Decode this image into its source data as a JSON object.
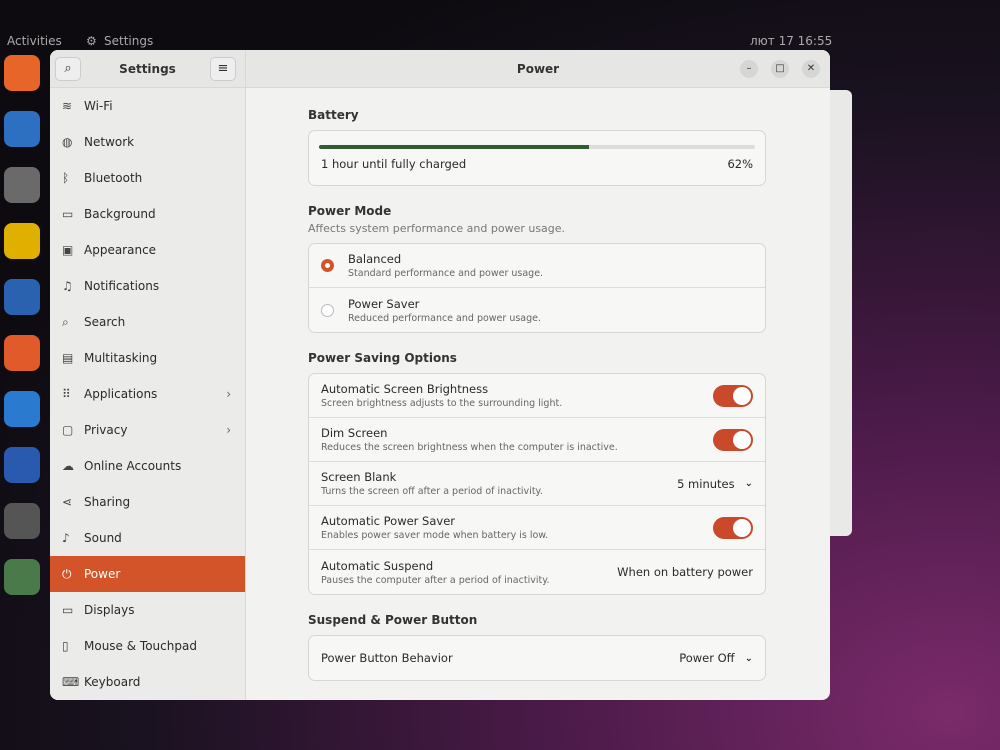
{
  "topbar": {
    "activities": "Activities",
    "app": "Settings",
    "datetime": "лют 17  16:55"
  },
  "dock": [
    {
      "icon": "firefox-icon",
      "color": "#e8652a"
    },
    {
      "icon": "thunderbird-icon",
      "color": "#2d6fc0"
    },
    {
      "icon": "files-icon",
      "color": "#6a6a6a"
    },
    {
      "icon": "rhythmbox-icon",
      "color": "#e0b000"
    },
    {
      "icon": "writer-icon",
      "color": "#2a62b0"
    },
    {
      "icon": "software-icon",
      "color": "#e05a2a"
    },
    {
      "icon": "help-icon",
      "color": "#2a7ad0"
    },
    {
      "icon": "updater-icon",
      "color": "#2a5ab0"
    },
    {
      "icon": "settings-icon",
      "color": "#555"
    },
    {
      "icon": "trash-icon",
      "color": "#4a7a4a"
    }
  ],
  "sidebar": {
    "title": "Settings",
    "items": [
      {
        "label": "Wi-Fi",
        "icon": "wifi-icon",
        "glyph": "≋"
      },
      {
        "label": "Network",
        "icon": "network-icon",
        "glyph": "◍"
      },
      {
        "label": "Bluetooth",
        "icon": "bluetooth-icon",
        "glyph": "ᛒ"
      },
      {
        "label": "Background",
        "icon": "background-icon",
        "glyph": "▭"
      },
      {
        "label": "Appearance",
        "icon": "appearance-icon",
        "glyph": "▣"
      },
      {
        "label": "Notifications",
        "icon": "bell-icon",
        "glyph": "♫"
      },
      {
        "label": "Search",
        "icon": "search-icon",
        "glyph": "⌕"
      },
      {
        "label": "Multitasking",
        "icon": "multitasking-icon",
        "glyph": "▤"
      },
      {
        "label": "Applications",
        "icon": "apps-icon",
        "glyph": "⠿",
        "chev": "›"
      },
      {
        "label": "Privacy",
        "icon": "lock-icon",
        "glyph": "▢",
        "chev": "›"
      },
      {
        "label": "Online Accounts",
        "icon": "cloud-icon",
        "glyph": "☁"
      },
      {
        "label": "Sharing",
        "icon": "share-icon",
        "glyph": "⋖"
      },
      {
        "label": "Sound",
        "icon": "music-icon",
        "glyph": "♪"
      },
      {
        "label": "Power",
        "icon": "power-icon",
        "glyph": "⏻",
        "active": true
      },
      {
        "label": "Displays",
        "icon": "display-icon",
        "glyph": "▭"
      },
      {
        "label": "Mouse & Touchpad",
        "icon": "mouse-icon",
        "glyph": "▯"
      },
      {
        "label": "Keyboard",
        "icon": "keyboard-icon",
        "glyph": "⌨"
      }
    ]
  },
  "main": {
    "title": "Power",
    "battery": {
      "heading": "Battery",
      "status": "1 hour until fully charged",
      "percent": "62%",
      "level": 0.62
    },
    "power_mode": {
      "heading": "Power Mode",
      "subtitle": "Affects system performance and power usage.",
      "options": [
        {
          "label": "Balanced",
          "desc": "Standard performance and power usage.",
          "selected": true
        },
        {
          "label": "Power Saver",
          "desc": "Reduced performance and power usage.",
          "selected": false
        }
      ]
    },
    "saving": {
      "heading": "Power Saving Options",
      "rows": [
        {
          "label": "Automatic Screen Brightness",
          "desc": "Screen brightness adjusts to the surrounding light.",
          "toggle": true
        },
        {
          "label": "Dim Screen",
          "desc": "Reduces the screen brightness when the computer is inactive.",
          "toggle": true
        },
        {
          "label": "Screen Blank",
          "desc": "Turns the screen off after a period of inactivity.",
          "value": "5 minutes",
          "dropdown": true
        },
        {
          "label": "Automatic Power Saver",
          "desc": "Enables power saver mode when battery is low.",
          "toggle": true
        },
        {
          "label": "Automatic Suspend",
          "desc": "Pauses the computer after a period of inactivity.",
          "value": "When on battery power"
        }
      ]
    },
    "suspend": {
      "heading": "Suspend & Power Button",
      "rows": [
        {
          "label": "Power Button Behavior",
          "value": "Power Off"
        }
      ]
    }
  },
  "colors": {
    "accent": "#d4542a",
    "toggle": "#c9492a"
  }
}
